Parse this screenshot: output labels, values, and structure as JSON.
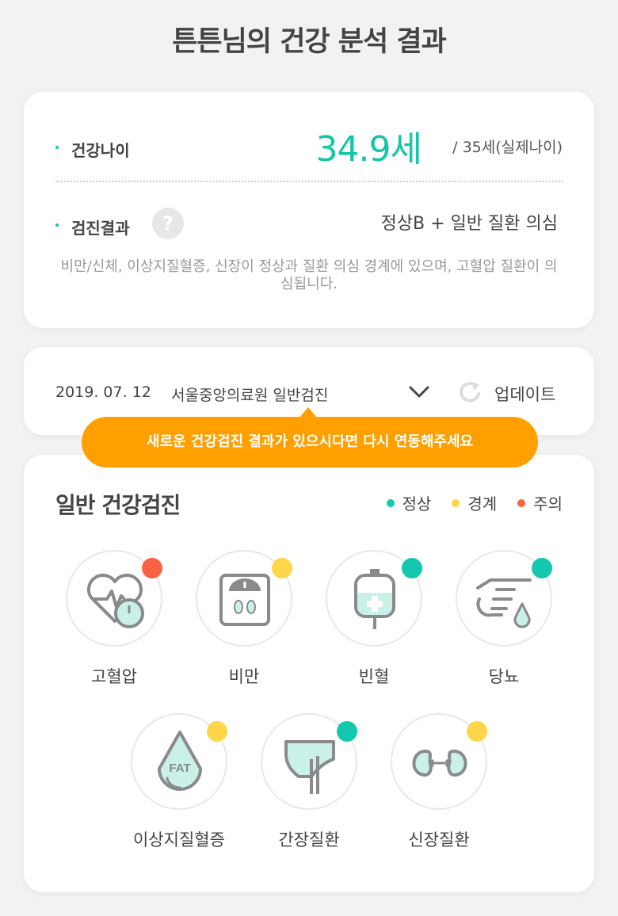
{
  "header": {
    "title": "튼튼님의 건강 분석 결과"
  },
  "summary": {
    "health_age_label": "건강나이",
    "health_age_value": "34.9세",
    "real_age": "/ 35세(실제나이)",
    "result_label": "검진결과",
    "help_icon_glyph": "?",
    "result_value": "정상B + 일반 질환 의심",
    "result_description": "비만/신체, 이상지질혈증, 신장이 정상과 질환 의심 경계에 있으며, 고혈압 질환이 의심됩니다."
  },
  "checkup": {
    "date": "2019. 07. 12",
    "hospital": "서울중앙의료원 일반검진",
    "update_label": "업데이트"
  },
  "tooltip": {
    "text": "새로운 건강검진 결과가 있으시다면 다시 연동해주세요"
  },
  "general": {
    "title": "일반 건강검진",
    "legend": [
      {
        "label": "정상",
        "color": "#13c8ae"
      },
      {
        "label": "경계",
        "color": "#ffd54a"
      },
      {
        "label": "주의",
        "color": "#f86245"
      }
    ],
    "items": [
      {
        "name": "고혈압",
        "status": "주의",
        "icon": "heart-pressure-icon"
      },
      {
        "name": "비만",
        "status": "경계",
        "icon": "scale-icon"
      },
      {
        "name": "빈혈",
        "status": "정상",
        "icon": "blood-bag-icon"
      },
      {
        "name": "당뇨",
        "status": "정상",
        "icon": "finger-blood-drop-icon"
      },
      {
        "name": "이상지질혈증",
        "status": "경계",
        "icon": "fat-drop-icon",
        "icon_text": "FAT"
      },
      {
        "name": "간장질환",
        "status": "정상",
        "icon": "liver-icon"
      },
      {
        "name": "신장질환",
        "status": "경계",
        "icon": "kidney-icon"
      }
    ]
  },
  "colors": {
    "accent": "#14c6a7",
    "tooltip": "#ff9f00",
    "normal": "#13c8ae",
    "borderline": "#ffd54a",
    "caution": "#f86245"
  }
}
